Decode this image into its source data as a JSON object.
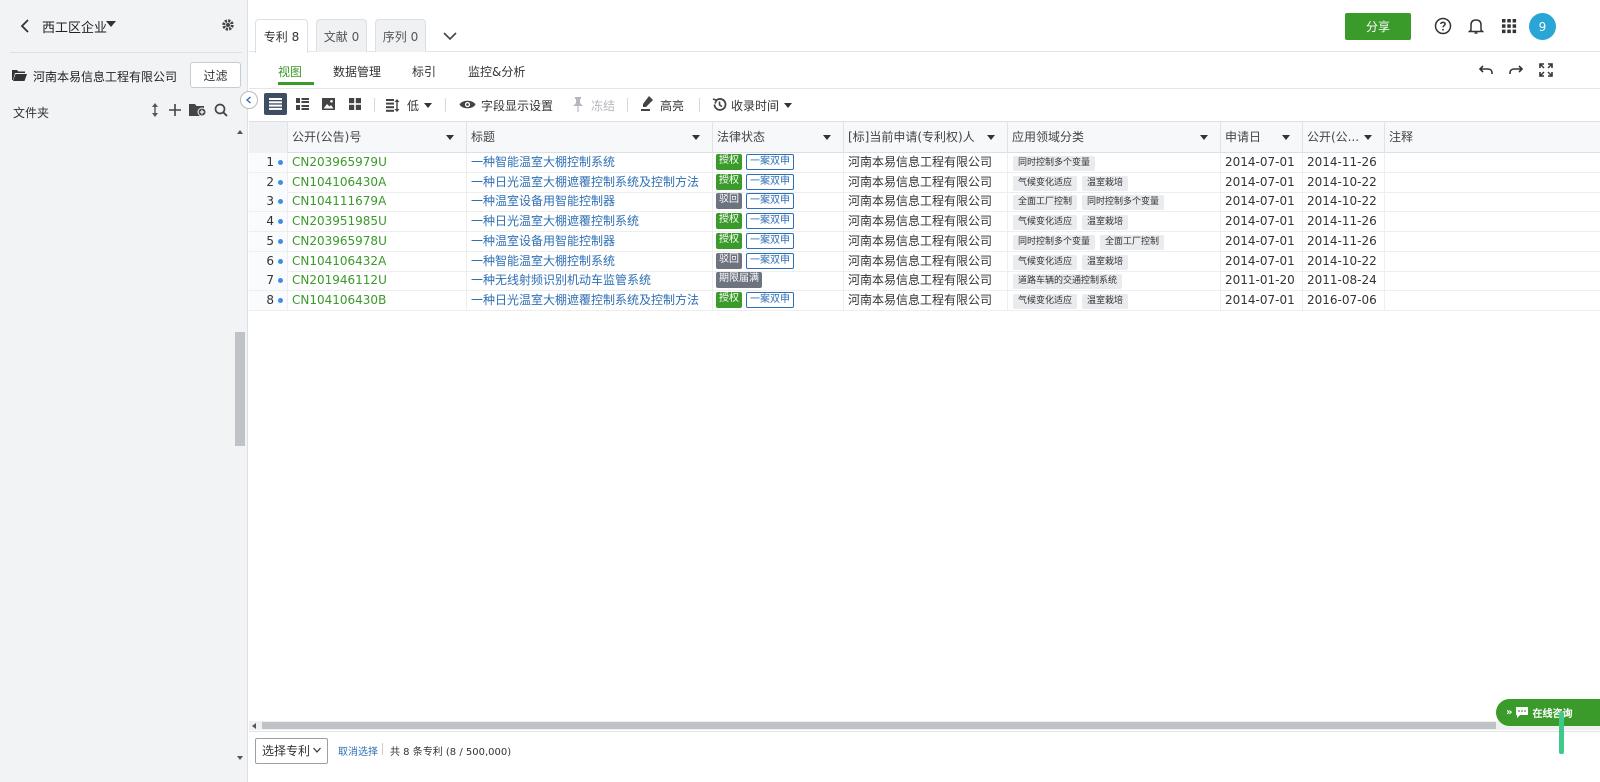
{
  "sidebar": {
    "org_name": "西工区企业",
    "company": "河南本易信息工程有限公司",
    "filter_label": "过滤",
    "folder_label": "文件夹"
  },
  "topbar": {
    "tabs": [
      {
        "label": "专利 8",
        "active": true
      },
      {
        "label": "文献 0",
        "active": false
      },
      {
        "label": "序列 0",
        "active": false
      }
    ],
    "share_label": "分享",
    "avatar_text": "9",
    "accent_color": "#3a9a2a"
  },
  "subnav": {
    "items": [
      {
        "label": "视图",
        "active": true
      },
      {
        "label": "数据管理",
        "active": false
      },
      {
        "label": "标引",
        "active": false
      },
      {
        "label": "监控&分析",
        "active": false
      }
    ]
  },
  "toolbar": {
    "density_label": "低",
    "fields_label": "字段显示设置",
    "freeze_label": "冻结",
    "highlight_label": "高亮",
    "sort_label": "收录时间"
  },
  "table": {
    "columns": [
      {
        "label": "公开(公告)号"
      },
      {
        "label": "标题"
      },
      {
        "label": "法律状态"
      },
      {
        "label": "[标]当前申请(专利权)人"
      },
      {
        "label": "应用领域分类"
      },
      {
        "label": "申请日"
      },
      {
        "label": "公开(公..."
      },
      {
        "label": "注释"
      }
    ],
    "rows": [
      {
        "num": "1",
        "pub": "CN203965979U",
        "title": "一种智能温室大棚控制系统",
        "status": "授权",
        "status_type": "green",
        "extra": "一案双申",
        "applicant": "河南本易信息工程有限公司",
        "tags": [
          "同时控制多个变量"
        ],
        "app_date": "2014-07-01",
        "pub_date": "2014-11-26"
      },
      {
        "num": "2",
        "pub": "CN104106430A",
        "title": "一种日光温室大棚遮覆控制系统及控制方法",
        "status": "授权",
        "status_type": "green",
        "extra": "一案双申",
        "applicant": "河南本易信息工程有限公司",
        "tags": [
          "气候变化适应",
          "温室栽培"
        ],
        "app_date": "2014-07-01",
        "pub_date": "2014-10-22"
      },
      {
        "num": "3",
        "pub": "CN104111679A",
        "title": "一种温室设备用智能控制器",
        "status": "驳回",
        "status_type": "gray",
        "extra": "一案双申",
        "applicant": "河南本易信息工程有限公司",
        "tags": [
          "全面工厂控制",
          "同时控制多个变量"
        ],
        "app_date": "2014-07-01",
        "pub_date": "2014-10-22"
      },
      {
        "num": "4",
        "pub": "CN203951985U",
        "title": "一种日光温室大棚遮覆控制系统",
        "status": "授权",
        "status_type": "green",
        "extra": "一案双申",
        "applicant": "河南本易信息工程有限公司",
        "tags": [
          "气候变化适应",
          "温室栽培"
        ],
        "app_date": "2014-07-01",
        "pub_date": "2014-11-26"
      },
      {
        "num": "5",
        "pub": "CN203965978U",
        "title": "一种温室设备用智能控制器",
        "status": "授权",
        "status_type": "green",
        "extra": "一案双申",
        "applicant": "河南本易信息工程有限公司",
        "tags": [
          "同时控制多个变量",
          "全面工厂控制"
        ],
        "app_date": "2014-07-01",
        "pub_date": "2014-11-26"
      },
      {
        "num": "6",
        "pub": "CN104106432A",
        "title": "一种智能温室大棚控制系统",
        "status": "驳回",
        "status_type": "gray",
        "extra": "一案双申",
        "applicant": "河南本易信息工程有限公司",
        "tags": [
          "气候变化适应",
          "温室栽培"
        ],
        "app_date": "2014-07-01",
        "pub_date": "2014-10-22"
      },
      {
        "num": "7",
        "pub": "CN201946112U",
        "title": "一种无线射频识别机动车监管系统",
        "status": "期限届满",
        "status_type": "gray",
        "extra": "",
        "applicant": "河南本易信息工程有限公司",
        "tags": [
          "道路车辆的交通控制系统"
        ],
        "app_date": "2011-01-20",
        "pub_date": "2011-08-24"
      },
      {
        "num": "8",
        "pub": "CN104106430B",
        "title": "一种日光温室大棚遮覆控制系统及控制方法",
        "status": "授权",
        "status_type": "green",
        "extra": "一案双申",
        "applicant": "河南本易信息工程有限公司",
        "tags": [
          "气候变化适应",
          "温室栽培"
        ],
        "app_date": "2014-07-01",
        "pub_date": "2016-07-06"
      }
    ]
  },
  "footer": {
    "select_label": "选择专利",
    "cancel_label": "取消选择",
    "count_text": "共 8 条专利 (8 / 500,000)"
  },
  "chat": {
    "label": "在线咨询"
  }
}
